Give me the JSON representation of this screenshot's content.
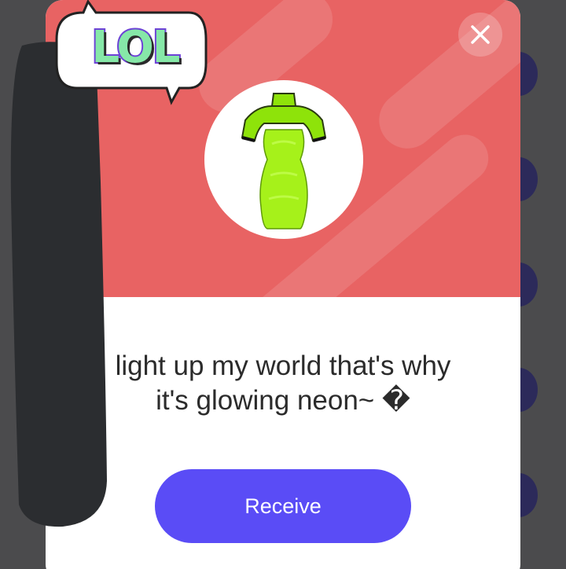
{
  "dialog": {
    "message_line1": "light up my world that's why",
    "message_line2": "it's glowing neon~ �",
    "receive_label": "Receive",
    "close_icon": "close-icon",
    "item_icon": "neon-green-dress-icon"
  },
  "sticker": {
    "text": "LOL"
  },
  "colors": {
    "header": "#e86363",
    "button": "#5a4cf6",
    "item": "#8ee30a"
  }
}
